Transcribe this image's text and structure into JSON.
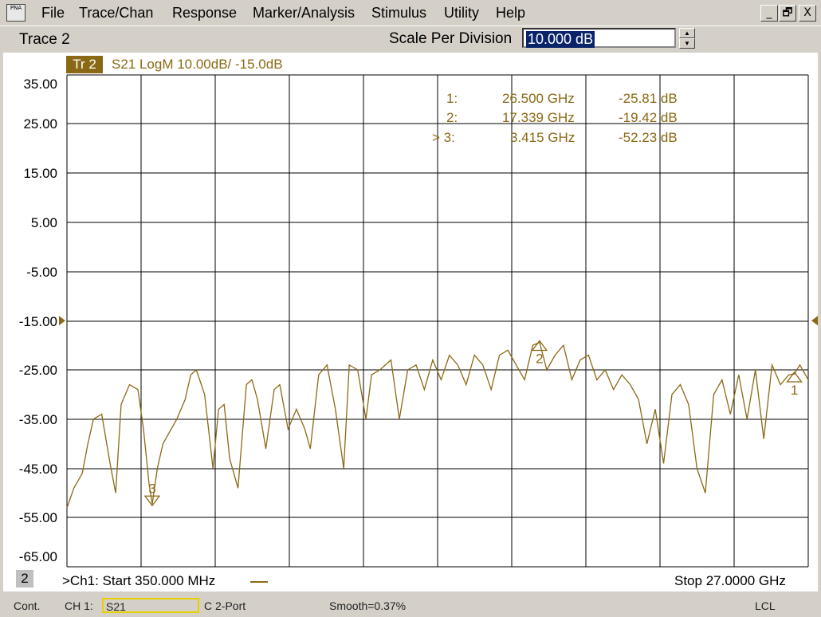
{
  "menu": {
    "icon_text": "PNA",
    "items": [
      "File",
      "Trace/Chan",
      "Response",
      "Marker/Analysis",
      "Stimulus",
      "Utility",
      "Help"
    ],
    "window_buttons": [
      "_",
      "🗗",
      "X"
    ]
  },
  "toolbar": {
    "active_trace": "Trace 2",
    "scale_label": "Scale Per Division",
    "scale_value": "10.000 dB"
  },
  "trace": {
    "tag": "Tr 2",
    "title": "S21 LogM 10.00dB/  -15.0dB",
    "color": "#8b6914"
  },
  "markers": [
    {
      "label": "1:",
      "freq": "26.500 GHz",
      "value": "-25.81 dB"
    },
    {
      "label": "2:",
      "freq": "17.339 GHz",
      "value": "-19.42 dB"
    },
    {
      "label": "> 3:",
      "freq": "3.415 GHz",
      "value": "-52.23 dB"
    }
  ],
  "channel": {
    "number": "2",
    "start": ">Ch1: Start  350.000 MHz",
    "stop": "Stop  27.0000 GHz"
  },
  "status": {
    "mode": "Cont.",
    "channel": "CH 1:",
    "param": "S21",
    "cal": "C  2-Port",
    "smooth": "Smooth=0.37%",
    "remote": "LCL"
  },
  "chart_data": {
    "type": "line",
    "title": "S21 LogM 10.00dB/  -15.0dB",
    "xlabel": "",
    "ylabel": "",
    "xlim": [
      0.35,
      27.0
    ],
    "ylim": [
      -65,
      35
    ],
    "y_ticks": [
      "35.00",
      "25.00",
      "15.00",
      "5.00",
      "-5.00",
      "-15.00",
      "-25.00",
      "-35.00",
      "-45.00",
      "-55.00",
      "-65.00"
    ],
    "reference_level": -15,
    "grid": true,
    "series": [
      {
        "name": "S21",
        "x": [
          0.35,
          0.6,
          0.9,
          1.1,
          1.3,
          1.6,
          1.9,
          2.1,
          2.3,
          2.6,
          2.9,
          3.1,
          3.3,
          3.415,
          3.6,
          3.8,
          4.0,
          4.3,
          4.6,
          4.8,
          5.0,
          5.3,
          5.6,
          5.8,
          6.0,
          6.2,
          6.5,
          6.8,
          7.0,
          7.2,
          7.5,
          7.8,
          8.0,
          8.3,
          8.6,
          8.9,
          9.1,
          9.4,
          9.7,
          10.0,
          10.3,
          10.5,
          10.8,
          11.1,
          11.3,
          11.6,
          12.0,
          12.3,
          12.6,
          12.9,
          13.2,
          13.5,
          13.8,
          14.1,
          14.4,
          14.7,
          15.0,
          15.3,
          15.6,
          15.9,
          16.2,
          16.5,
          16.8,
          17.1,
          17.339,
          17.6,
          17.9,
          18.2,
          18.5,
          18.8,
          19.1,
          19.4,
          19.7,
          20.0,
          20.3,
          20.6,
          20.9,
          21.2,
          21.5,
          21.8,
          22.1,
          22.4,
          22.7,
          23.0,
          23.3,
          23.6,
          23.9,
          24.2,
          24.5,
          24.8,
          25.1,
          25.4,
          25.7,
          26.0,
          26.3,
          26.5,
          26.7,
          27.0
        ],
        "values": [
          -53,
          -49,
          -46,
          -40,
          -35,
          -34,
          -44,
          -50,
          -32,
          -28,
          -29,
          -37,
          -48,
          -52.23,
          -45,
          -40,
          -38,
          -35,
          -31,
          -26,
          -25,
          -30,
          -45,
          -33,
          -32,
          -43,
          -49,
          -28,
          -27,
          -31,
          -41,
          -29,
          -28,
          -37,
          -33,
          -37,
          -41,
          -26,
          -24,
          -33,
          -45,
          -24,
          -25,
          -35,
          -26,
          -25,
          -23,
          -35,
          -25,
          -24,
          -29,
          -23,
          -27,
          -22,
          -24,
          -28,
          -22,
          -24,
          -29,
          -22,
          -21,
          -24,
          -27,
          -20,
          -19.42,
          -25,
          -22,
          -20,
          -27,
          -23,
          -22,
          -27,
          -25,
          -29,
          -26,
          -28,
          -31,
          -40,
          -33,
          -44,
          -30,
          -28,
          -32,
          -45,
          -50,
          -30,
          -27,
          -34,
          -26,
          -35,
          -25,
          -39,
          -24,
          -28,
          -26,
          -25.81,
          -24,
          -27
        ]
      }
    ],
    "markers": [
      {
        "id": "1",
        "x": 26.5,
        "y": -25.81
      },
      {
        "id": "2",
        "x": 17.339,
        "y": -19.42
      },
      {
        "id": "3",
        "x": 3.415,
        "y": -52.23
      }
    ]
  }
}
